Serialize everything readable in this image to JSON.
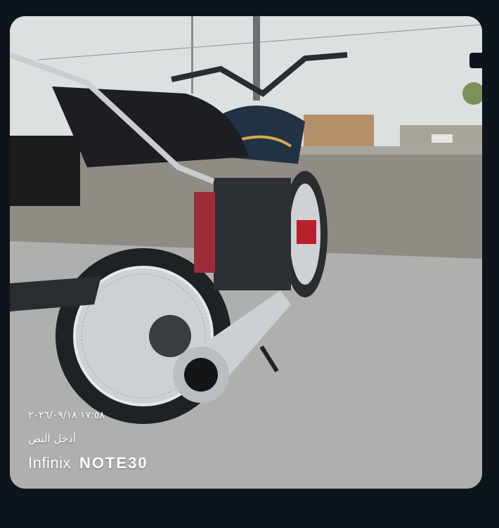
{
  "photo": {
    "subject": "motorcycle-photo",
    "colors": {
      "sky": "#dfe1e2",
      "ground": "#b7b8b6",
      "gravel": "#8e8b86",
      "chrome": "#d9dde0",
      "tank": "#223040",
      "accent": "#c0283b"
    }
  },
  "watermark": {
    "timestamp": "١٧:٥٨ ٢٠٢٦/٠٩/١٨",
    "caption": "أدخل النص",
    "brand_maker": "Infinix",
    "brand_model": "NOTE30"
  }
}
